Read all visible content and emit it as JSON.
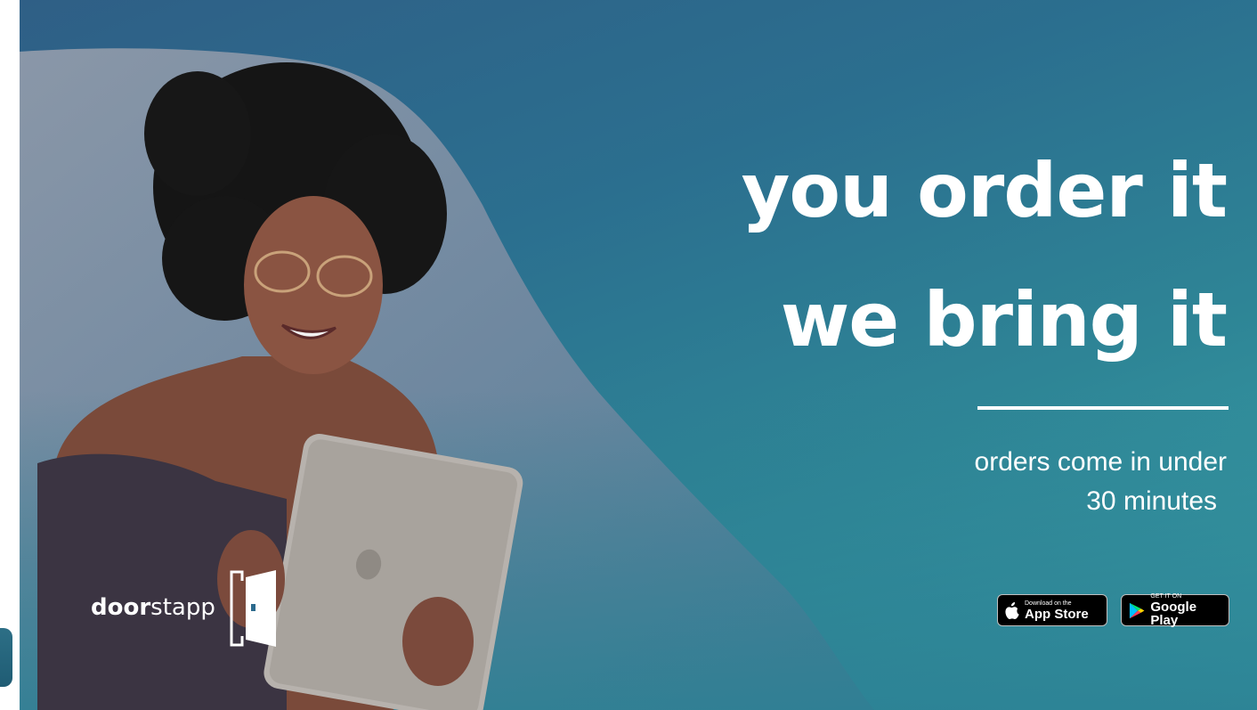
{
  "headline": {
    "line1": "you order it",
    "line2": "we bring it"
  },
  "tagline": {
    "line1": "orders come in under",
    "line2": "30 minutes"
  },
  "app_store": {
    "small": "Download on the",
    "big": "App Store"
  },
  "google_play": {
    "small": "GET IT ON",
    "big": "Google Play"
  },
  "logo": {
    "bold": "door",
    "regular": "stapp"
  },
  "colors": {
    "background_start": "#2f5f86",
    "background_end": "#3aa3a8",
    "text": "#ffffff"
  }
}
